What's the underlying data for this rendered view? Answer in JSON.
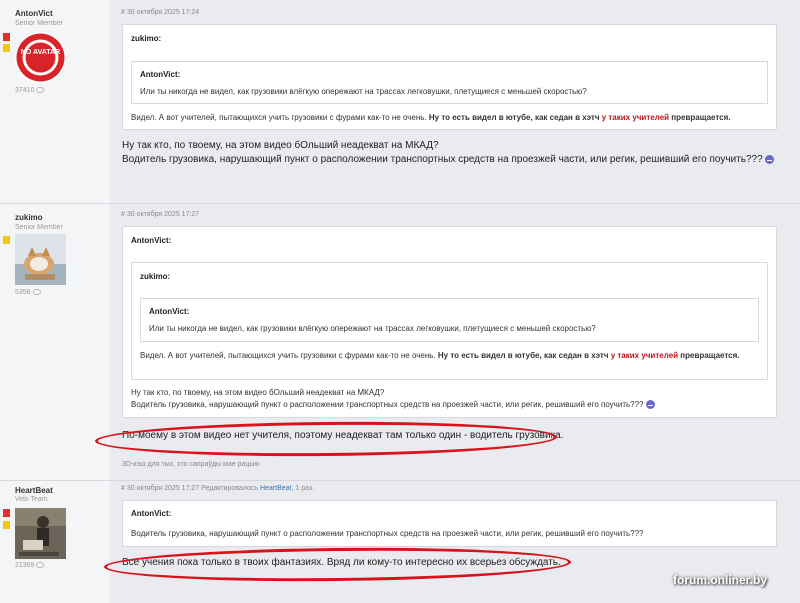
{
  "posts": [
    {
      "author": "AntonVict",
      "rank": "Senior Member",
      "avatar_text": "NO AVATAR",
      "count": "37410",
      "meta": "# 30 октября 2025 17:24",
      "quote": {
        "author": "zukimo:",
        "inner": {
          "author": "AntonVict:",
          "text": "Или ты никогда не видел, как грузовики влёгкую опережают на трассах легковушки, плетущиеся с меньшей скоростью?"
        },
        "text_plain": "Видел. А вот учителей, пытающихся учить грузовики с фурами как-то не очень.",
        "text_bold": "Ну то есть видел в ютубе, как седан в хэтч",
        "text_red": "у таких учителей",
        "text_bold2": "превращается."
      },
      "body_line1": "Ну так кто, по твоему, на этом видео бОльший неадекват на МКАД?",
      "body_line2": "Водитель грузовика, нарушающий пункт о расположении транспортных средств на проезжей части, или регик, решивший его поучить???"
    },
    {
      "author": "zukimo",
      "rank": "Senior Member",
      "count": "5356",
      "meta": "# 30 октября 2025 17:27",
      "quote": {
        "author": "AntonVict:",
        "inner": {
          "author": "zukimo:",
          "inner": {
            "author": "AntonVict:",
            "text": "Или ты никогда не видел, как грузовики влёгкую опережают на трассах легковушки, плетущиеся с меньшей скоростью?"
          },
          "text_plain": "Видел. А вот учителей, пытающихся учить грузовики с фурами как-то не очень.",
          "text_bold": "Ну то есть видел в ютубе, как седан в хэтч",
          "text_red": "у таких учителей",
          "text_bold2": "превращается."
        },
        "text_line1": "Ну так кто, по твоему, на этом видео бОльший неадекват на МКАД?",
        "text_line2": "Водитель грузовика, нарушающий пункт о расположении транспортных средств на проезжей части, или регик, решивший его поучить???"
      },
      "body": "По-моему в этом видео нет учителя, поэтому неадекват там только один - водитель грузовика.",
      "signature": "3D-кэш для тых, хто сапраўды мае рацыю"
    },
    {
      "author": "HeartBeat",
      "rank": "Velo Team",
      "count": "21369",
      "meta_prefix": "# 30 октября 2025 17:27 Редактировалось",
      "meta_editor": "HeartBeat",
      "meta_suffix": ", 1 раз.",
      "quote": {
        "author": "AntonVict:",
        "text": "Водитель грузовика, нарушающий пункт о расположении транспортных средств на проезжей части, или регик, решивший его поучить???"
      },
      "body": "Все учения пока только в твоих фантазиях. Вряд ли кому-то интересно их всерьез обсуждать."
    }
  ],
  "watermark": "forum.onliner.by",
  "colors": {
    "flag_red": "#e0312b",
    "flag_yellow": "#f3c613",
    "highlight_red": "#c0141b",
    "ellipse": "#d9131e"
  }
}
